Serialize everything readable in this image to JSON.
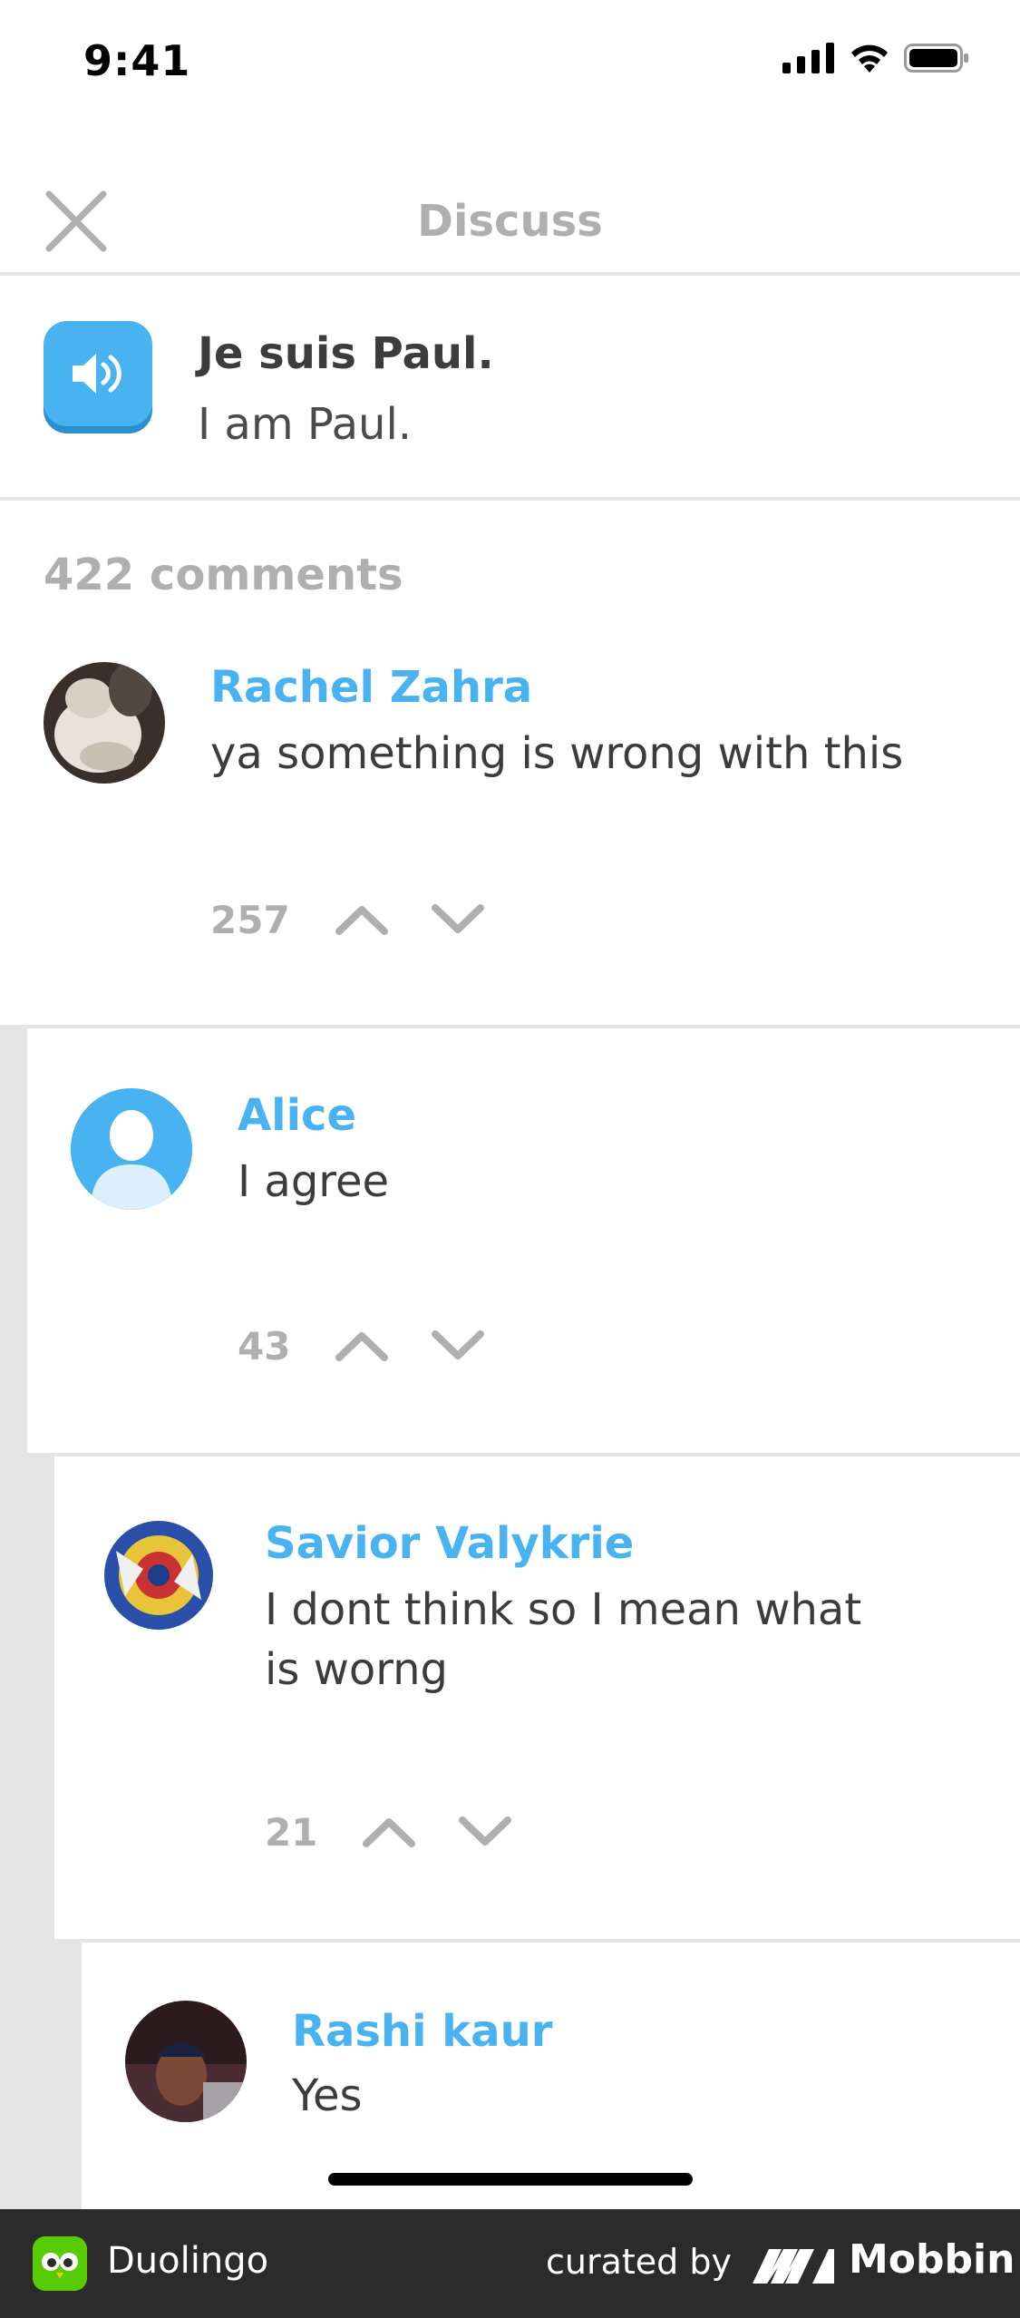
{
  "status": {
    "time": "9:41"
  },
  "header": {
    "title": "Discuss"
  },
  "sentence": {
    "text": "Je suis Paul.",
    "translation": "I am Paul."
  },
  "comments_header": {
    "count_label": "422 comments"
  },
  "comments": [
    {
      "username": "Rachel Zahra",
      "text": "ya something is wrong with this",
      "votes": "257"
    },
    {
      "username": "Alice",
      "text": "I agree",
      "votes": "43"
    },
    {
      "username": "Savior Valykrie",
      "text": "I dont think so I mean what is worng",
      "votes": "21"
    },
    {
      "username": "Rashi kaur",
      "text": "Yes"
    }
  ],
  "footer": {
    "app_name": "Duolingo",
    "curated_label": "curated by",
    "brand": "Mobbin"
  },
  "colors": {
    "accent": "#49b3f1",
    "muted": "#afafaf",
    "text": "#3c3c3c",
    "divider": "#e5e5e5",
    "owl_green": "#58cc02"
  }
}
